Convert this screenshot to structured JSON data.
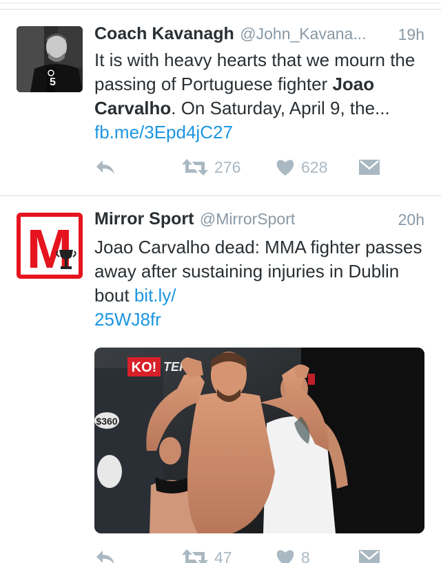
{
  "tweets": [
    {
      "author_name": "Coach Kavanagh",
      "handle": "@John_Kavana...",
      "time": "19h",
      "text_intro": "It is with heavy hearts that we mourn the passing of Portuguese fighter ",
      "text_bold": "Joao Carvalho",
      "text_rest": ". On Saturday, April 9, the... ",
      "link": "fb.me/3Epd4jC27",
      "avatar_caption": "5",
      "retweets": "276",
      "likes": "628"
    },
    {
      "author_name": "Mirror Sport",
      "handle": "@MirrorSport",
      "time": "20h",
      "text": "Joao Carvalho dead: MMA fighter passes away after sustaining injuries in Dublin bout ",
      "link": "bit.ly/\n25WJ8fr",
      "avatar_letter": "M",
      "media_banner_1": "KO!",
      "media_banner_2": "TEF",
      "media_sign": "$360",
      "retweets": "47",
      "likes": "8"
    }
  ],
  "colors": {
    "link": "#1b95e0",
    "secondary": "#8899a6",
    "action_icon": "#aab8c2",
    "mirror_red": "#e5141f"
  },
  "icons": [
    "reply-icon",
    "retweet-icon",
    "heart-icon",
    "direct-message-icon"
  ]
}
